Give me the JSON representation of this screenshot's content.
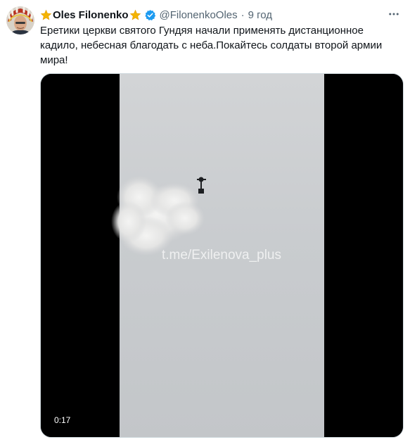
{
  "tweet": {
    "display_name": "Oles Filonenko",
    "handle": "@FilonenkoOles",
    "separator": "·",
    "timestamp": "9 год",
    "text": "Еретики церкви святого Гундяя начали применять дистанционное кадило, небесная благодать с неба.Покайтесь солдаты второй армии мира!",
    "icons": {
      "name_prefix": "star-icon",
      "name_suffix": "star-icon",
      "verified": "verified-badge-icon",
      "more": "more-options-icon"
    },
    "colors": {
      "verified": "#1d9bf0",
      "star": "#f4b400",
      "secondary_text": "#536471"
    }
  },
  "video": {
    "watermark": "t.me/Exilenova_plus",
    "duration": "0:17"
  }
}
